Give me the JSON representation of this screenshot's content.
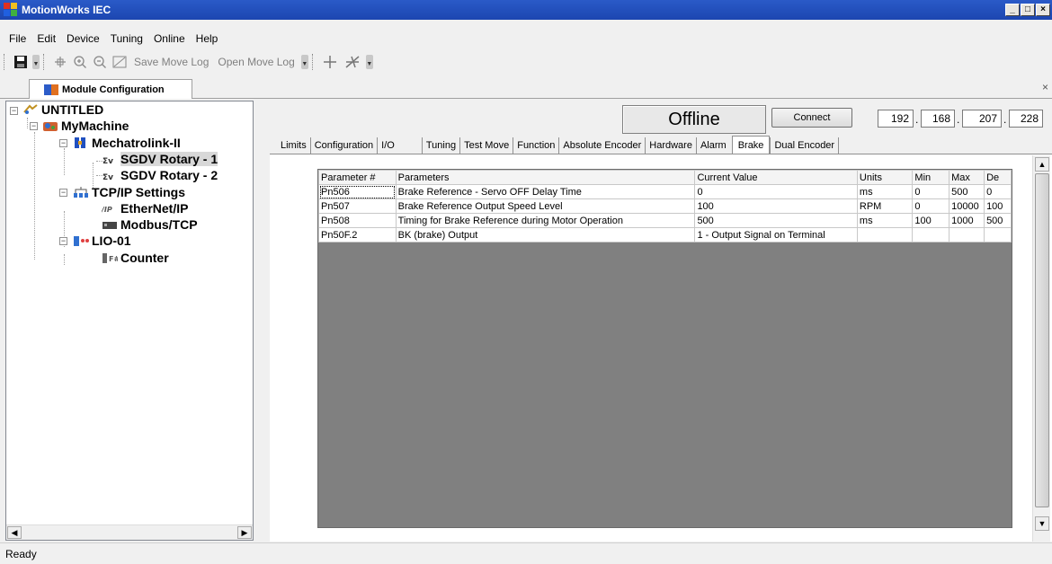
{
  "window": {
    "title": "MotionWorks IEC",
    "minimize": "_",
    "maximize": "□",
    "close": "×"
  },
  "menu": [
    "File",
    "Edit",
    "Device",
    "Tuning",
    "Online",
    "Help"
  ],
  "toolbar": {
    "save_move_log": "Save Move Log",
    "open_move_log": "Open Move Log"
  },
  "doc_tab": {
    "label": "Module Configuration",
    "close": "×"
  },
  "tree": {
    "root": "UNTITLED",
    "machine": "MyMachine",
    "mechatrolink": "Mechatrolink-II",
    "axis1": "SGDV Rotary - 1",
    "axis2": "SGDV Rotary - 2",
    "tcpip": "TCP/IP Settings",
    "ethernetip": "EtherNet/IP",
    "modbus": "Modbus/TCP",
    "lio": "LIO-01",
    "counter": "Counter"
  },
  "connection": {
    "status": "Offline",
    "connect_label": "Connect",
    "ip": [
      "192",
      "168",
      "207",
      "228"
    ]
  },
  "tabs": [
    "Limits",
    "Configuration",
    "I/O",
    "Tuning",
    "Test Move",
    "Function",
    "Absolute Encoder",
    "Hardware",
    "Alarm",
    "Brake",
    "Dual Encoder"
  ],
  "active_tab": "Brake",
  "grid": {
    "headers": [
      "Parameter #",
      "Parameters",
      "Current Value",
      "Units",
      "Min",
      "Max",
      "De"
    ],
    "rows": [
      [
        "Pn506",
        "Brake Reference - Servo OFF Delay Time",
        "0",
        "ms",
        "0",
        "500",
        "0"
      ],
      [
        "Pn507",
        "Brake Reference Output Speed Level",
        "100",
        "RPM",
        "0",
        "10000",
        "100"
      ],
      [
        "Pn508",
        "Timing for Brake Reference  during Motor Operation",
        "500",
        "ms",
        "100",
        "1000",
        "500"
      ],
      [
        "Pn50F.2",
        "BK (brake) Output",
        "1 - Output Signal on Terminal",
        "",
        "",
        "",
        ""
      ]
    ]
  },
  "status_bar": "Ready"
}
